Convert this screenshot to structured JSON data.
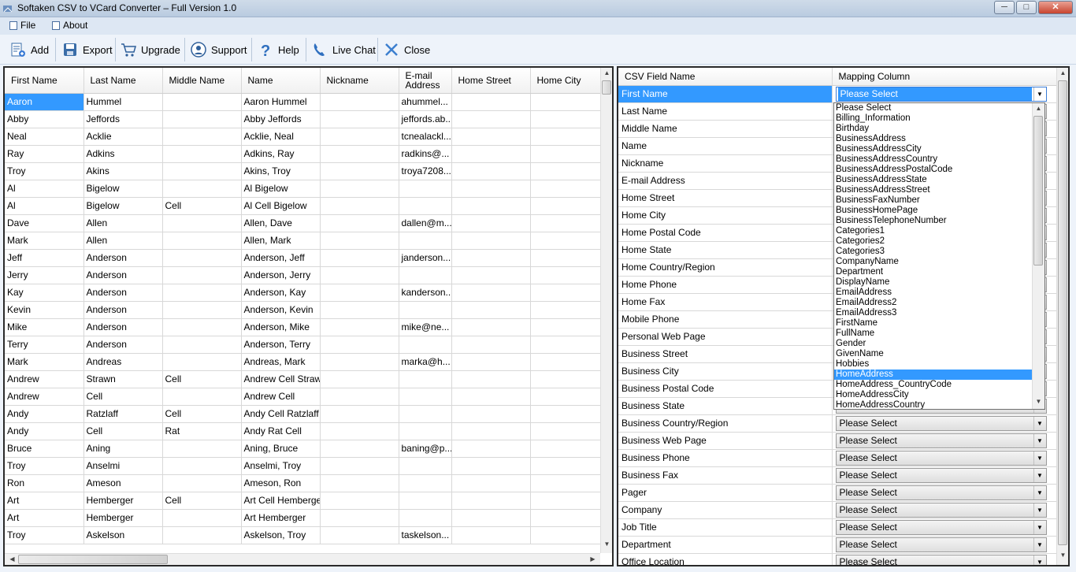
{
  "window": {
    "title": "Softaken CSV to VCard Converter – Full Version 1.0",
    "min": "─",
    "max": "□",
    "close": "✕"
  },
  "menu": [
    {
      "label": "File"
    },
    {
      "label": "About"
    }
  ],
  "toolbar": [
    {
      "label": "Add",
      "icon": "add-icon"
    },
    {
      "label": "Export",
      "icon": "save-icon"
    },
    {
      "label": "Upgrade",
      "icon": "cart-icon"
    },
    {
      "label": "Support",
      "icon": "support-icon"
    },
    {
      "label": "Help",
      "icon": "help-icon"
    },
    {
      "label": "Live Chat",
      "icon": "phone-icon"
    },
    {
      "label": "Close",
      "icon": "close-icon"
    }
  ],
  "grid": {
    "columns": [
      "First Name",
      "Last Name",
      "Middle Name",
      "Name",
      "Nickname",
      "E-mail Address",
      "Home Street",
      "Home City"
    ],
    "rows": [
      [
        "Aaron",
        "Hummel",
        "",
        "Aaron Hummel",
        "",
        "ahummel...",
        "",
        ""
      ],
      [
        "Abby",
        "Jeffords",
        "",
        "Abby Jeffords",
        "",
        "jeffords.ab...",
        "",
        ""
      ],
      [
        "Neal",
        "Acklie",
        "",
        "Acklie, Neal",
        "",
        "tcnealackl...",
        "",
        ""
      ],
      [
        "Ray",
        "Adkins",
        "",
        "Adkins, Ray",
        "",
        "radkins@...",
        "",
        ""
      ],
      [
        "Troy",
        "Akins",
        "",
        "Akins, Troy",
        "",
        "troya7208...",
        "",
        ""
      ],
      [
        "Al",
        "Bigelow",
        "",
        "Al Bigelow",
        "",
        "",
        "",
        ""
      ],
      [
        "Al",
        "Bigelow",
        "Cell",
        "Al Cell Bigelow",
        "",
        "",
        "",
        ""
      ],
      [
        "Dave",
        "Allen",
        "",
        "Allen, Dave",
        "",
        "dallen@m...",
        "",
        ""
      ],
      [
        "Mark",
        "Allen",
        "",
        "Allen, Mark",
        "",
        "",
        "",
        ""
      ],
      [
        "Jeff",
        "Anderson",
        "",
        "Anderson, Jeff",
        "",
        "janderson...",
        "",
        ""
      ],
      [
        "Jerry",
        "Anderson",
        "",
        "Anderson, Jerry",
        "",
        "",
        "",
        ""
      ],
      [
        "Kay",
        "Anderson",
        "",
        "Anderson, Kay",
        "",
        "kanderson...",
        "",
        ""
      ],
      [
        "Kevin",
        "Anderson",
        "",
        "Anderson, Kevin",
        "",
        "",
        "",
        ""
      ],
      [
        "Mike",
        "Anderson",
        "",
        "Anderson, Mike",
        "",
        "mike@ne...",
        "",
        ""
      ],
      [
        "Terry",
        "Anderson",
        "",
        "Anderson, Terry",
        "",
        "",
        "",
        ""
      ],
      [
        "Mark",
        "Andreas",
        "",
        "Andreas, Mark",
        "",
        "marka@h...",
        "",
        ""
      ],
      [
        "Andrew",
        "Strawn",
        "Cell",
        "Andrew Cell Strawn",
        "",
        "",
        "",
        ""
      ],
      [
        "Andrew",
        "Cell",
        "",
        "Andrew Cell",
        "",
        "",
        "",
        ""
      ],
      [
        "Andy",
        "Ratzlaff",
        "Cell",
        "Andy Cell Ratzlaff",
        "",
        "",
        "",
        ""
      ],
      [
        "Andy",
        "Cell",
        "Rat",
        "Andy Rat Cell",
        "",
        "",
        "",
        ""
      ],
      [
        "Bruce",
        "Aning",
        "",
        "Aning, Bruce",
        "",
        "baning@p...",
        "",
        ""
      ],
      [
        "Troy",
        "Anselmi",
        "",
        "Anselmi, Troy",
        "",
        "",
        "",
        ""
      ],
      [
        "Ron",
        "Ameson",
        "",
        "Ameson, Ron",
        "",
        "",
        "",
        ""
      ],
      [
        "Art",
        "Hemberger",
        "Cell",
        "Art Cell Hemberger",
        "",
        "",
        "",
        ""
      ],
      [
        "Art",
        "Hemberger",
        "",
        "Art Hemberger",
        "",
        "",
        "",
        ""
      ],
      [
        "Troy",
        "Askelson",
        "",
        "Askelson, Troy",
        "",
        "taskelson...",
        "",
        ""
      ]
    ]
  },
  "mapping": {
    "headers": [
      "CSV Field Name",
      "Mapping Column"
    ],
    "fields": [
      "First Name",
      "Last Name",
      "Middle Name",
      "Name",
      "Nickname",
      "E-mail Address",
      "Home Street",
      "Home City",
      "Home Postal Code",
      "Home State",
      "Home Country/Region",
      "Home Phone",
      "Home Fax",
      "Mobile Phone",
      "Personal Web Page",
      "Business Street",
      "Business City",
      "Business Postal Code",
      "Business State",
      "Business Country/Region",
      "Business Web Page",
      "Business Phone",
      "Business Fax",
      "Pager",
      "Company",
      "Job Title",
      "Department",
      "Office Location"
    ],
    "selected_value": "Please Select",
    "placeholder": "Please Select",
    "dropdown_options": [
      "Please Select",
      "Billing_Information",
      "Birthday",
      "BusinessAddress",
      "BusinessAddressCity",
      "BusinessAddressCountry",
      "BusinessAddressPostalCode",
      "BusinessAddressState",
      "BusinessAddressStreet",
      "BusinessFaxNumber",
      "BusinessHomePage",
      "BusinessTelephoneNumber",
      "Categories1",
      "Categories2",
      "Categories3",
      "CompanyName",
      "Department",
      "DisplayName",
      "EmailAddress",
      "EmailAddress2",
      "EmailAddress3",
      "FirstName",
      "FullName",
      "Gender",
      "GivenName",
      "Hobbies",
      "HomeAddress",
      "HomeAddress_CountryCode",
      "HomeAddressCity",
      "HomeAddressCountry"
    ],
    "highlighted_option": "HomeAddress"
  },
  "colors": {
    "selection": "#3399ff",
    "titlebar": "#c6d5e7"
  }
}
